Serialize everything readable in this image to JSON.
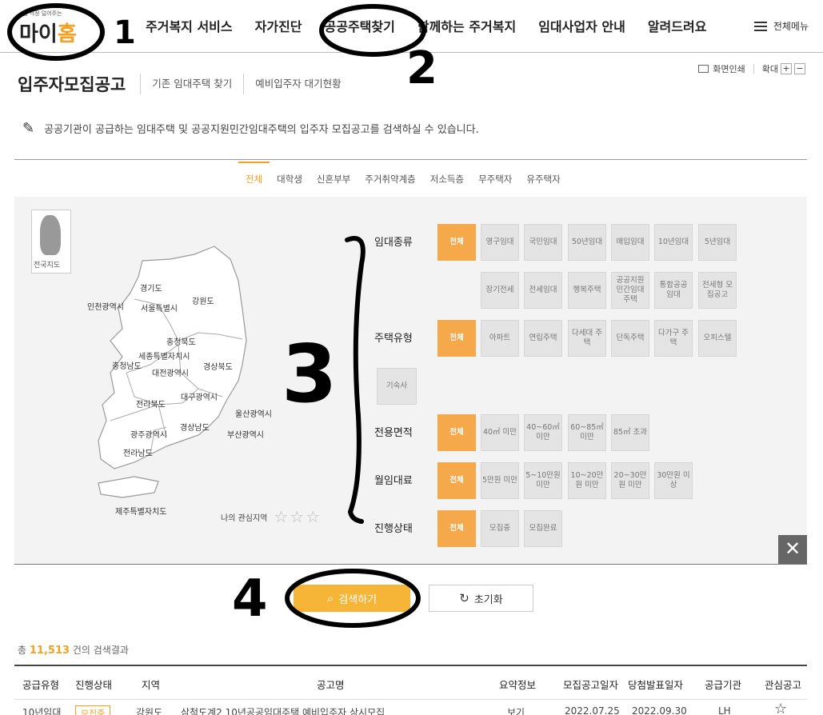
{
  "header": {
    "logo_tagline": "집 걱정 덜어주는",
    "logo_name_a": "마이",
    "logo_name_b": "홈",
    "nav": [
      "주거복지 서비스",
      "자가진단",
      "공공주택찾기",
      "함께하는 주거복지",
      "임대사업자 안내",
      "알려드려요"
    ],
    "all_menu": "전체메뉴"
  },
  "tools": {
    "print": "화면인쇄",
    "zoom": "확대",
    "zoom_in": "+",
    "zoom_out": "−"
  },
  "page": {
    "title": "입주자모집공고",
    "sublinks": [
      "기존 임대주택 찾기",
      "예비입주자 대기현황"
    ],
    "description": "공공기관이 공급하는 임대주택 및 공공지원민간임대주택의 입주자 모집공고를 검색하실 수 있습니다."
  },
  "tabs": [
    "전체",
    "대학생",
    "신혼부부",
    "주거취약계층",
    "저소득층",
    "무주택자",
    "유주택자"
  ],
  "map": {
    "thumb_caption": "전국지도",
    "regions": [
      "경기도",
      "인천광역시",
      "서울특별시",
      "강원도",
      "충청북도",
      "세종특별자치시",
      "충청남도",
      "대전광역시",
      "경상북도",
      "대구광역시",
      "전라북도",
      "울산광역시",
      "경상남도",
      "광주광역시",
      "부산광역시",
      "전라남도",
      "제주특별자치도"
    ],
    "my_region_label": "나의 관심지역",
    "star": "☆"
  },
  "filters": {
    "rental_type": {
      "label": "임대종류",
      "options": [
        "전체",
        "영구임대",
        "국민임대",
        "50년임대",
        "매입임대",
        "10년임대",
        "5년임대",
        "장기전세",
        "전세임대",
        "행복주택",
        "공공지원 민간임대 주택",
        "통합공공 임대",
        "전세형 모집공고"
      ]
    },
    "housing_type": {
      "label": "주택유형",
      "options": [
        "전체",
        "아파트",
        "연립주택",
        "다세대 주택",
        "단독주택",
        "다가구 주택",
        "오피스텔",
        "기숙사"
      ]
    },
    "area": {
      "label": "전용면적",
      "options": [
        "전체",
        "40㎡ 미만",
        "40~60㎡ 미만",
        "60~85㎡ 미만",
        "85㎡ 초과"
      ]
    },
    "rent": {
      "label": "월임대료",
      "options": [
        "전체",
        "5만원 미만",
        "5~10만원 미만",
        "10~20만원 미만",
        "20~30만원 미만",
        "30만원 이상"
      ]
    },
    "status": {
      "label": "진행상태",
      "options": [
        "전체",
        "모집중",
        "모집완료"
      ]
    },
    "close": "✕"
  },
  "actions": {
    "search": "검색하기",
    "reset": "초기화",
    "search_icon": "⌕",
    "reset_icon": "↻"
  },
  "results": {
    "count_prefix": "총",
    "count": "11,513",
    "count_suffix": "건의 검색결과",
    "columns": [
      "공급유형",
      "진행상태",
      "지역",
      "공고명",
      "요약정보",
      "모집공고일자",
      "당첨발표일자",
      "공급기관",
      "관심공고"
    ],
    "rows": [
      [
        "10년임대",
        "모집중",
        "강원도",
        "삼척도계2 10년공공임대주택 예비입주자 상시모집",
        "보기",
        "2022.07.25",
        "2022.09.30",
        "LH",
        "☆"
      ]
    ]
  },
  "annotations": [
    "1",
    "2",
    "3",
    "4"
  ]
}
